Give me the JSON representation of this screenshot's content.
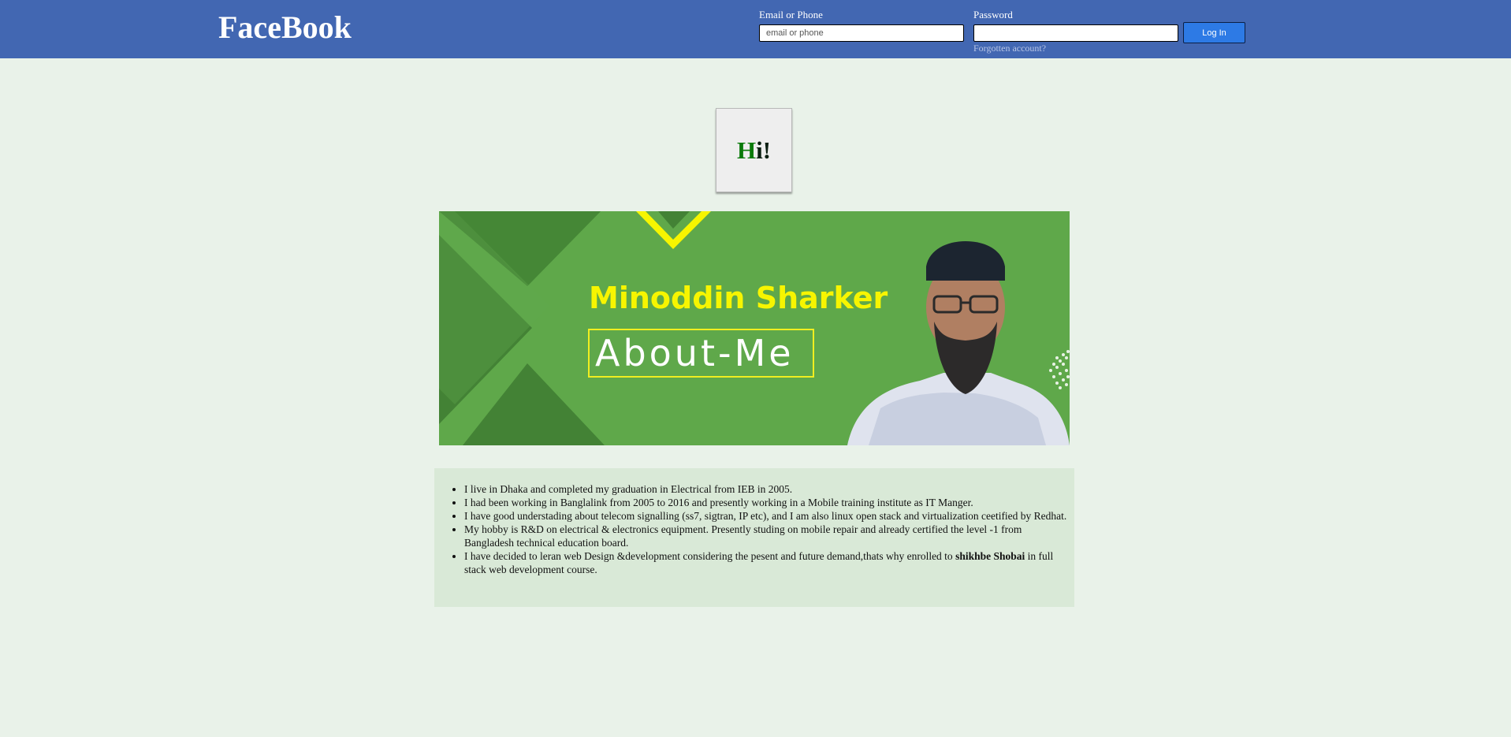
{
  "header": {
    "brand": "FaceBook",
    "email_label": "Email or Phone",
    "email_placeholder": "email or phone",
    "password_label": "Password",
    "password_placeholder": "",
    "forgot_link": "Forgotten account?",
    "login_button": "Log In",
    "bg_color": "#4267b2",
    "button_color": "#2d7ae5"
  },
  "greeting": {
    "first_letter": "H",
    "rest": "i!"
  },
  "banner": {
    "name": "Minoddin Sharker",
    "subtitle": "About-Me",
    "portrait_icon": "person-portrait",
    "bg_color": "#5fa84a",
    "accent_color": "#f7f500"
  },
  "about": {
    "items": [
      {
        "text": "I live in Dhaka and completed my graduation in Electrical from IEB in 2005."
      },
      {
        "text": "I had been working in Banglalink from 2005 to 2016 and presently working in a Mobile training institute as IT Manger."
      },
      {
        "text": "I have good understading about telecom signalling (ss7, sigtran, IP etc), and I am also linux open stack and virtualization ceetified by Redhat."
      },
      {
        "text": "My hobby is R&D on electrical & electronics equipment. Presently studing on mobile repair and already certified the level -1 from Bangladesh technical education board."
      },
      {
        "text_before": "I have decided to leran web Design &development considering the pesent and future demand,thats why enrolled to ",
        "bold": "shikhbe Shobai",
        "text_after": " in full stack web development course."
      }
    ]
  }
}
